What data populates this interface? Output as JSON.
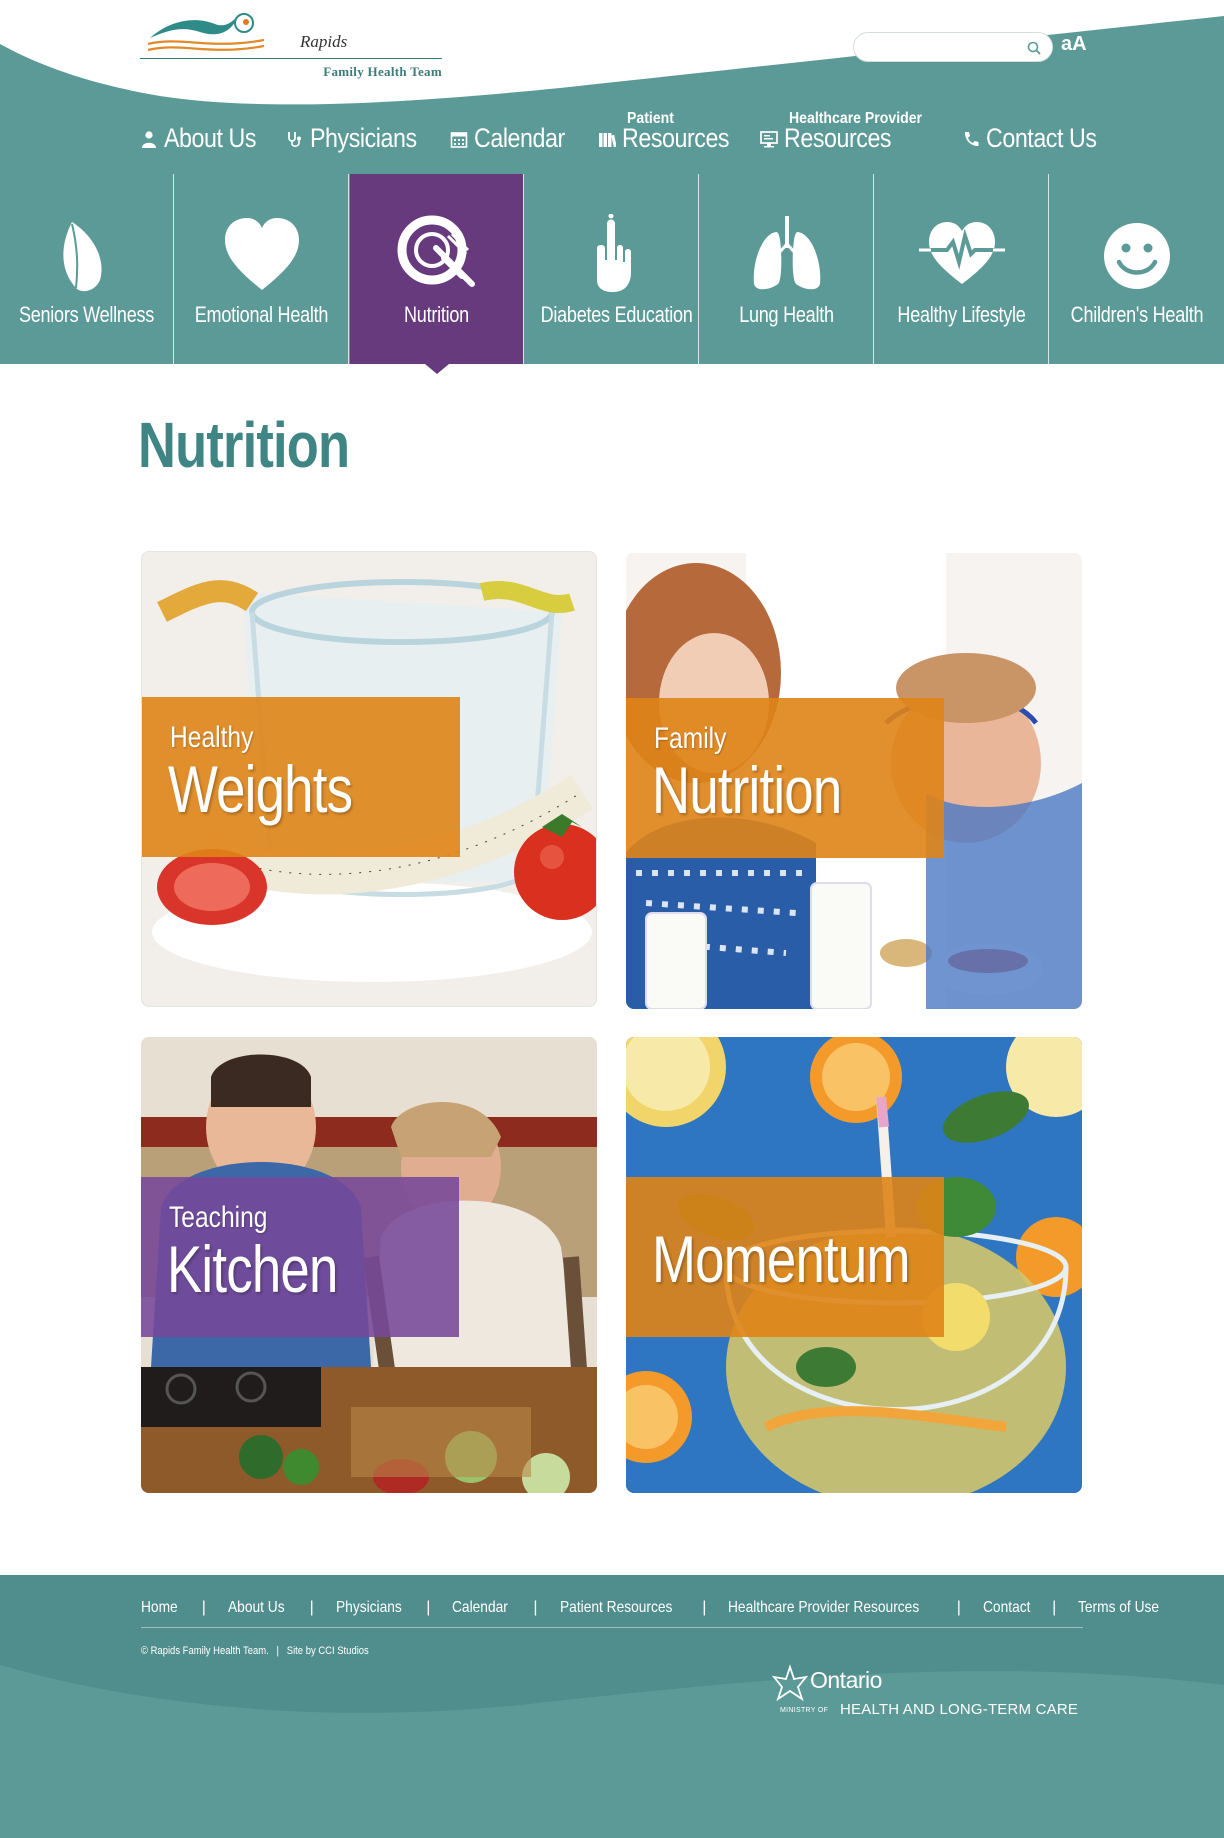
{
  "site": {
    "logo_name": "Rapids",
    "logo_subtitle": "Family Health Team",
    "text_size_label": "aA",
    "search": {
      "placeholder": ""
    }
  },
  "mainnav": [
    {
      "prefix": "",
      "label": "About Us",
      "icon": "person-icon"
    },
    {
      "prefix": "",
      "label": "Physicians",
      "icon": "stethoscope-icon"
    },
    {
      "prefix": "",
      "label": "Calendar",
      "icon": "calendar-icon"
    },
    {
      "prefix": "Patient",
      "label": "Resources",
      "icon": "books-icon"
    },
    {
      "prefix": "Healthcare Provider",
      "label": "Resources",
      "icon": "monitor-icon"
    },
    {
      "prefix": "",
      "label": "Contact Us",
      "icon": "phone-icon"
    }
  ],
  "categories": [
    {
      "label": "Seniors Wellness",
      "icon": "leaf-icon",
      "active": false
    },
    {
      "label": "Emotional Health",
      "icon": "heart-icon",
      "active": false
    },
    {
      "label": "Nutrition",
      "icon": "plate-fork-knife-icon",
      "active": true
    },
    {
      "label": "Diabetes Education",
      "icon": "finger-prick-icon",
      "active": false
    },
    {
      "label": "Lung Health",
      "icon": "lungs-icon",
      "active": false
    },
    {
      "label": "Healthy Lifestyle",
      "icon": "heartbeat-icon",
      "active": false
    },
    {
      "label": "Children's Health",
      "icon": "smiley-icon",
      "active": false
    }
  ],
  "page": {
    "title": "Nutrition"
  },
  "tiles": [
    {
      "small": "Healthy",
      "big": "Weights",
      "panel_color": "orange"
    },
    {
      "small": "Family",
      "big": "Nutrition",
      "panel_color": "orange"
    },
    {
      "small": "Teaching",
      "big": "Kitchen",
      "panel_color": "purple"
    },
    {
      "small": "",
      "big": "Momentum",
      "panel_color": "orange"
    }
  ],
  "footer": {
    "links": [
      "Home",
      "About Us",
      "Physicians",
      "Calendar",
      "Patient Resources",
      "Healthcare Provider Resources",
      "Contact",
      "Terms of Use"
    ],
    "copyright": "© Rapids Family Health Team.",
    "credit": "Site by CCI Studios",
    "ontario": {
      "name": "Ontario",
      "ministry_of": "MINISTRY OF",
      "department": "HEALTH AND LONG-TERM CARE"
    }
  },
  "colors": {
    "teal": "#5b9a97",
    "teal_dark": "#4f8e8c",
    "purple": "#673a7e",
    "orange": "#df8417",
    "title_teal": "#3f8583"
  }
}
